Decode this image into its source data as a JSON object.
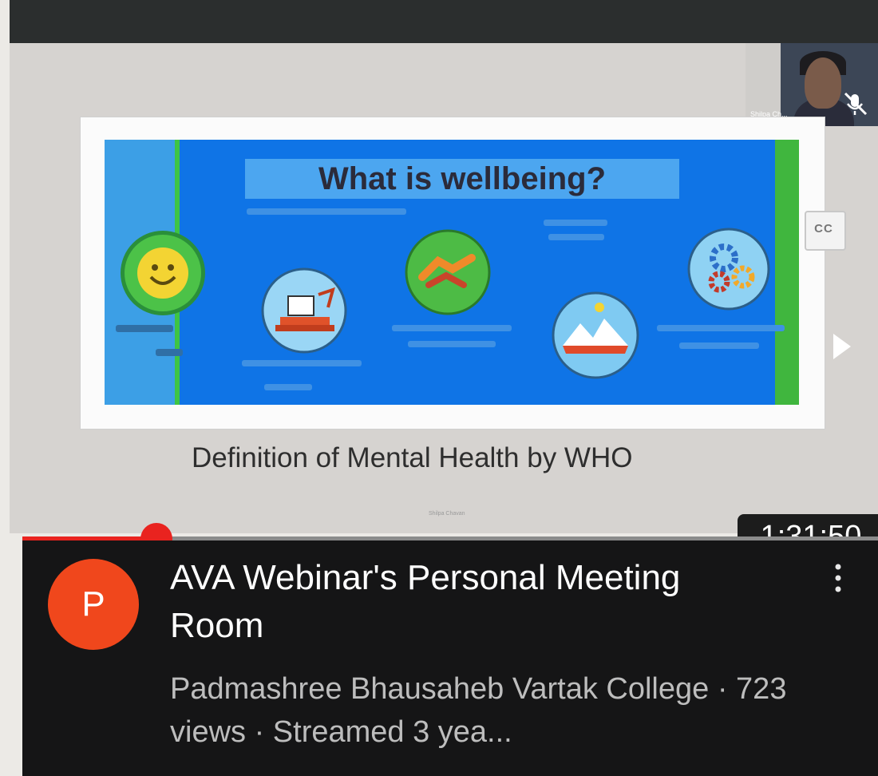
{
  "slide": {
    "title": "What is wellbeing?",
    "caption": "Definition of Mental Health by WHO",
    "watermark": "Shilpa Chavan"
  },
  "participant": {
    "name": "Shilpa Ch..."
  },
  "player": {
    "cc_label": "CC",
    "duration": "1:31:50",
    "progress_percent": 16
  },
  "video": {
    "channel_initial": "P",
    "title": "AVA Webinar's Personal Meeting Room",
    "meta": "Padmashree Bhausaheb Vartak College · 723 views · Streamed 3 yea..."
  },
  "colors": {
    "accent": "#e9231f",
    "avatar": "#f0471c",
    "slide_blue": "#0f74e6",
    "slide_green": "#3ec444"
  }
}
